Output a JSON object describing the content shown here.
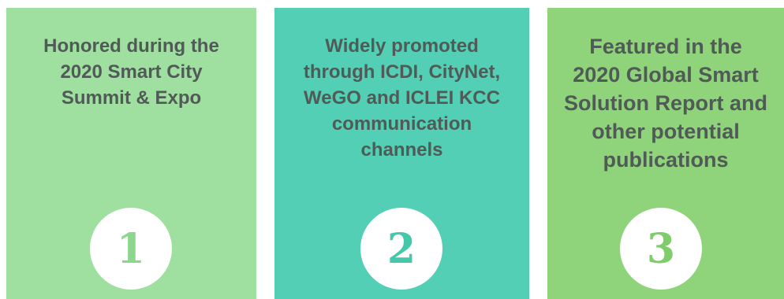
{
  "panels": [
    {
      "text": "Honored during the\n2020 Smart City\nSummit & Expo",
      "number": "1",
      "color": "#9fdf9f"
    },
    {
      "text": "Widely promoted\nthrough ICDI, CityNet,\nWeGO and ICLEI KCC\ncommunication\nchannels",
      "number": "2",
      "color": "#52cfb4"
    },
    {
      "text": "Featured in the\n2020 Global Smart\nSolution Report and\nother potential\npublications",
      "number": "3",
      "color": "#8fd47a"
    }
  ]
}
